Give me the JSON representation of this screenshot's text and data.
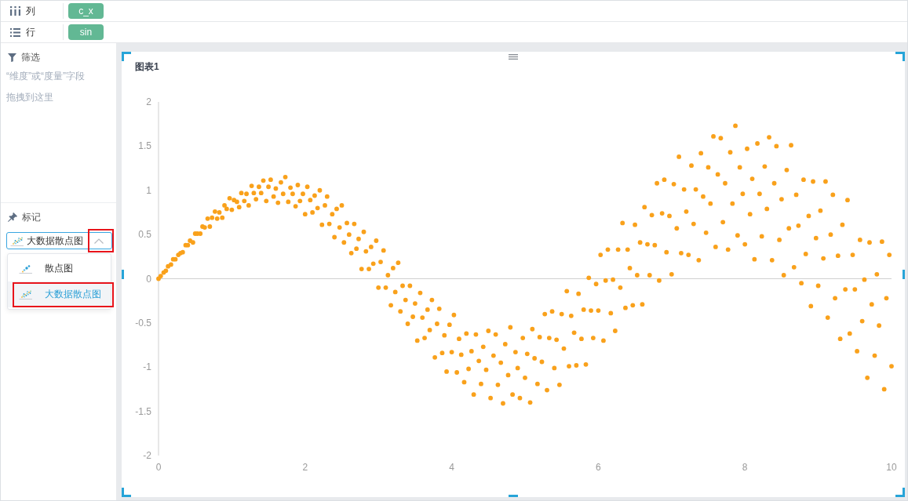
{
  "shelves": [
    {
      "kind": "columns",
      "label": "列",
      "pills": [
        "c_x"
      ]
    },
    {
      "kind": "rows",
      "label": "行",
      "pills": [
        "sin"
      ]
    }
  ],
  "filter": {
    "title": "筛选",
    "hint": "“维度”或“度量”字段拖拽到这里"
  },
  "marks": {
    "title": "标记",
    "select": {
      "value": "大数据散点图",
      "kind": "big-scatter",
      "expanded": true,
      "highlighted": true
    },
    "options": [
      {
        "label": "散点图",
        "kind": "scatter",
        "selected": false,
        "highlighted": false
      },
      {
        "label": "大数据散点图",
        "kind": "big-scatter",
        "selected": true,
        "highlighted": true
      }
    ]
  },
  "chart": {
    "title": "图表1",
    "selected": true,
    "chart_data": {
      "type": "scatter",
      "xlim": [
        0,
        10
      ],
      "ylim": [
        -2,
        2
      ],
      "xticks": [
        0,
        2,
        4,
        6,
        8,
        10
      ],
      "yticks": [
        -2,
        -1.5,
        -1,
        -0.5,
        0,
        0.5,
        1,
        1.5,
        2
      ],
      "x": [
        0,
        0.03,
        0.07,
        0.1,
        0.13,
        0.17,
        0.2,
        0.23,
        0.27,
        0.3,
        0.33,
        0.37,
        0.4,
        0.43,
        0.47,
        0.5,
        0.53,
        0.57,
        0.6,
        0.63,
        0.67,
        0.7,
        0.73,
        0.77,
        0.8,
        0.83,
        0.87,
        0.9,
        0.93,
        0.97,
        1,
        1.03,
        1.07,
        1.1,
        1.13,
        1.17,
        1.2,
        1.23,
        1.27,
        1.3,
        1.33,
        1.37,
        1.4,
        1.43,
        1.47,
        1.5,
        1.53,
        1.57,
        1.6,
        1.63,
        1.67,
        1.7,
        1.73,
        1.77,
        1.8,
        1.83,
        1.87,
        1.9,
        1.93,
        1.97,
        2,
        2.03,
        2.07,
        2.1,
        2.13,
        2.17,
        2.2,
        2.23,
        2.27,
        2.3,
        2.33,
        2.37,
        2.4,
        2.43,
        2.47,
        2.5,
        2.53,
        2.57,
        2.6,
        2.63,
        2.67,
        2.7,
        2.73,
        2.77,
        2.8,
        2.83,
        2.87,
        2.9,
        2.93,
        2.97,
        3,
        3.03,
        3.07,
        3.1,
        3.13,
        3.17,
        3.2,
        3.23,
        3.27,
        3.3,
        3.33,
        3.37,
        3.4,
        3.43,
        3.47,
        3.5,
        3.53,
        3.57,
        3.6,
        3.63,
        3.67,
        3.7,
        3.73,
        3.77,
        3.8,
        3.83,
        3.87,
        3.9,
        3.93,
        3.97,
        4,
        4.03,
        4.07,
        4.1,
        4.13,
        4.17,
        4.2,
        4.23,
        4.27,
        4.3,
        4.33,
        4.37,
        4.4,
        4.43,
        4.47,
        4.5,
        4.53,
        4.57,
        4.6,
        4.63,
        4.67,
        4.7,
        4.73,
        4.77,
        4.8,
        4.83,
        4.87,
        4.9,
        4.93,
        4.97,
        5,
        5.03,
        5.07,
        5.1,
        5.13,
        5.17,
        5.2,
        5.23,
        5.27,
        5.3,
        5.33,
        5.37,
        5.4,
        5.43,
        5.47,
        5.5,
        5.53,
        5.57,
        5.6,
        5.63,
        5.67,
        5.7,
        5.73,
        5.77,
        5.8,
        5.83,
        5.87,
        5.9,
        5.93,
        5.97,
        6,
        6.03,
        6.07,
        6.1,
        6.13,
        6.17,
        6.2,
        6.23,
        6.27,
        6.3,
        6.33,
        6.37,
        6.4,
        6.43,
        6.47,
        6.5,
        6.53,
        6.57,
        6.6,
        6.63,
        6.67,
        6.7,
        6.73,
        6.77,
        6.8,
        6.83,
        6.87,
        6.9,
        6.93,
        6.97,
        7,
        7.03,
        7.07,
        7.1,
        7.13,
        7.17,
        7.2,
        7.23,
        7.27,
        7.3,
        7.33,
        7.37,
        7.4,
        7.43,
        7.47,
        7.5,
        7.53,
        7.57,
        7.6,
        7.63,
        7.67,
        7.7,
        7.73,
        7.77,
        7.8,
        7.83,
        7.87,
        7.9,
        7.93,
        7.97,
        8,
        8.03,
        8.07,
        8.1,
        8.13,
        8.17,
        8.2,
        8.23,
        8.27,
        8.3,
        8.33,
        8.37,
        8.4,
        8.43,
        8.47,
        8.5,
        8.53,
        8.57,
        8.6,
        8.63,
        8.67,
        8.7,
        8.73,
        8.77,
        8.8,
        8.83,
        8.87,
        8.9,
        8.93,
        8.97,
        9,
        9.03,
        9.07,
        9.1,
        9.13,
        9.17,
        9.2,
        9.23,
        9.27,
        9.3,
        9.33,
        9.37,
        9.4,
        9.43,
        9.47,
        9.5,
        9.53,
        9.57,
        9.6,
        9.63,
        9.67,
        9.7,
        9.73,
        9.77,
        9.8,
        9.83,
        9.87,
        9.9,
        9.93,
        9.97,
        10
      ],
      "series": [
        {
          "color": "#f9a11b",
          "values": [
            0,
            0.03,
            0.07,
            0.09,
            0.14,
            0.16,
            0.22,
            0.22,
            0.27,
            0.29,
            0.3,
            0.38,
            0.38,
            0.43,
            0.41,
            0.51,
            0.51,
            0.51,
            0.59,
            0.58,
            0.68,
            0.59,
            0.69,
            0.76,
            0.68,
            0.75,
            0.69,
            0.83,
            0.79,
            0.91,
            0.78,
            0.89,
            0.87,
            0.81,
            0.97,
            0.88,
            0.96,
            0.83,
            1.05,
            0.97,
            0.9,
            1.04,
            0.97,
            1.11,
            0.88,
            1.04,
            1.12,
            0.93,
            1.02,
            0.86,
            1.09,
            0.96,
            1.15,
            0.87,
            1.03,
            0.96,
            0.82,
            1.06,
            0.88,
            0.96,
            0.73,
            1.04,
            0.89,
            0.75,
            0.94,
            0.8,
            1,
            0.61,
            0.83,
            0.93,
            0.62,
            0.73,
            0.47,
            0.79,
            0.58,
            0.83,
            0.41,
            0.63,
            0.5,
            0.29,
            0.62,
            0.34,
            0.45,
            0.11,
            0.53,
            0.31,
            0.11,
            0.36,
            0.17,
            0.43,
            -0.1,
            0.19,
            0.32,
            -0.1,
            0.04,
            -0.3,
            0.12,
            -0.15,
            0.18,
            -0.37,
            -0.08,
            -0.24,
            -0.51,
            -0.08,
            -0.43,
            -0.28,
            -0.7,
            -0.16,
            -0.44,
            -0.67,
            -0.35,
            -0.58,
            -0.24,
            -0.89,
            -0.51,
            -0.34,
            -0.84,
            -0.64,
            -1.05,
            -0.52,
            -0.83,
            -0.41,
            -1.06,
            -0.68,
            -0.86,
            -1.17,
            -0.62,
            -1.02,
            -0.82,
            -1.31,
            -0.63,
            -0.93,
            -1.19,
            -0.77,
            -1.03,
            -0.59,
            -1.35,
            -0.87,
            -0.63,
            -1.2,
            -0.95,
            -1.41,
            -0.74,
            -1.09,
            -0.55,
            -1.31,
            -0.83,
            -1.01,
            -1.35,
            -0.67,
            -1.12,
            -0.85,
            -1.4,
            -0.57,
            -0.9,
            -1.19,
            -0.66,
            -0.94,
            -0.4,
            -1.26,
            -0.67,
            -0.37,
            -1.01,
            -0.69,
            -1.2,
            -0.4,
            -0.79,
            -0.14,
            -0.99,
            -0.42,
            -0.61,
            -0.98,
            -0.17,
            -0.68,
            -0.35,
            -0.97,
            0.01,
            -0.36,
            -0.67,
            -0.06,
            -0.36,
            0.27,
            -0.7,
            -0.02,
            0.33,
            -0.39,
            -0.01,
            -0.59,
            0.33,
            -0.1,
            0.63,
            -0.33,
            0.33,
            0.12,
            -0.3,
            0.61,
            0.04,
            0.41,
            -0.29,
            0.81,
            0.39,
            0.04,
            0.72,
            0.38,
            1.08,
            -0.02,
            0.74,
            1.12,
            0.3,
            0.71,
            0.05,
            1.07,
            0.57,
            1.38,
            0.29,
            1.01,
            0.76,
            0.27,
            1.28,
            0.62,
            1.01,
            0.21,
            1.42,
            0.93,
            0.52,
            1.26,
            0.85,
            1.61,
            0.36,
            1.18,
            1.59,
            0.64,
            1.08,
            0.33,
            1.43,
            0.85,
            1.73,
            0.49,
            1.26,
            0.96,
            0.39,
            1.47,
            0.73,
            1.13,
            0.22,
            1.53,
            0.96,
            0.48,
            1.27,
            0.79,
            1.6,
            0.21,
            1.08,
            1.5,
            0.44,
            0.9,
            0.04,
            1.23,
            0.57,
            1.51,
            0.13,
            0.95,
            0.6,
            -0.05,
            1.12,
            0.28,
            0.71,
            -0.31,
            1.1,
            0.46,
            -0.08,
            0.77,
            0.23,
            1.1,
            -0.44,
            0.5,
            0.95,
            -0.22,
            0.26,
            -0.68,
            0.61,
            -0.12,
            0.89,
            -0.62,
            0.27,
            -0.12,
            -0.82,
            0.44,
            -0.48,
            -0.01,
            -1.12,
            0.41,
            -0.29,
            -0.87,
            0.05,
            -0.53,
            0.42,
            -1.25,
            -0.22,
            0.27,
            -0.99
          ]
        }
      ]
    }
  }
}
